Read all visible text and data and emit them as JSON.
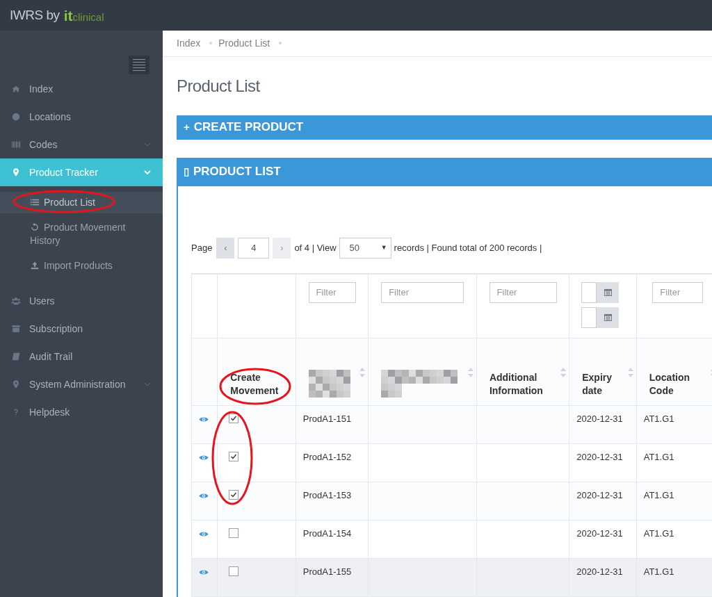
{
  "brand": {
    "text": "IWRS by",
    "logo_it": "it",
    "logo_clinical": "clinical"
  },
  "sidebar": {
    "items": [
      {
        "label": "Index",
        "selected": false
      },
      {
        "label": "Locations",
        "selected": false
      },
      {
        "label": "Codes",
        "selected": false,
        "expanded": false
      },
      {
        "label": "Product Tracker",
        "selected": true,
        "expanded": true,
        "children": [
          {
            "label": "Product List",
            "selected": true
          },
          {
            "label": "Product Movement History",
            "selected": false
          },
          {
            "label": "Import Products",
            "selected": false
          }
        ]
      },
      {
        "label": "Users",
        "selected": false
      },
      {
        "label": "Subscription",
        "selected": false
      },
      {
        "label": "Audit Trail",
        "selected": false
      },
      {
        "label": "System Administration",
        "selected": false,
        "expanded": false
      },
      {
        "label": "Helpdesk",
        "selected": false
      }
    ]
  },
  "breadcrumb": [
    "Index",
    "Product List"
  ],
  "page_title": "Product List",
  "panels": [
    {
      "icon": "+",
      "title": "CREATE PRODUCT"
    },
    {
      "icon": "▯",
      "title": "PRODUCT LIST"
    }
  ],
  "pagination": {
    "page_label": "Page",
    "prev": "‹",
    "page": "4",
    "next": "›",
    "of": "of 4 | View",
    "view": "50",
    "view_caret": "▼",
    "records": "records | Found total of 200 records |"
  },
  "table": {
    "columns": [
      {
        "kind": "icon"
      },
      {
        "kind": "check",
        "label": "Create Movement"
      },
      {
        "kind": "blurred",
        "placeholder": "Filter"
      },
      {
        "kind": "blurred",
        "placeholder": "Filter"
      },
      {
        "kind": "text",
        "label": "Additional Information",
        "placeholder": "Filter"
      },
      {
        "kind": "date",
        "label": "Expiry date"
      },
      {
        "kind": "text",
        "label": "Location Code",
        "placeholder": "Filter"
      }
    ],
    "rows": [
      {
        "checked": true,
        "code": "ProdA1-151",
        "expiry": "2020-12-31",
        "location": "AT1.G1"
      },
      {
        "checked": true,
        "code": "ProdA1-152",
        "expiry": "2020-12-31",
        "location": "AT1.G1"
      },
      {
        "checked": true,
        "code": "ProdA1-153",
        "expiry": "2020-12-31",
        "location": "AT1.G1"
      },
      {
        "checked": false,
        "code": "ProdA1-154",
        "expiry": "2020-12-31",
        "location": "AT1.G1"
      },
      {
        "checked": false,
        "code": "ProdA1-155",
        "expiry": "2020-12-31",
        "location": "AT1.G1"
      }
    ]
  }
}
